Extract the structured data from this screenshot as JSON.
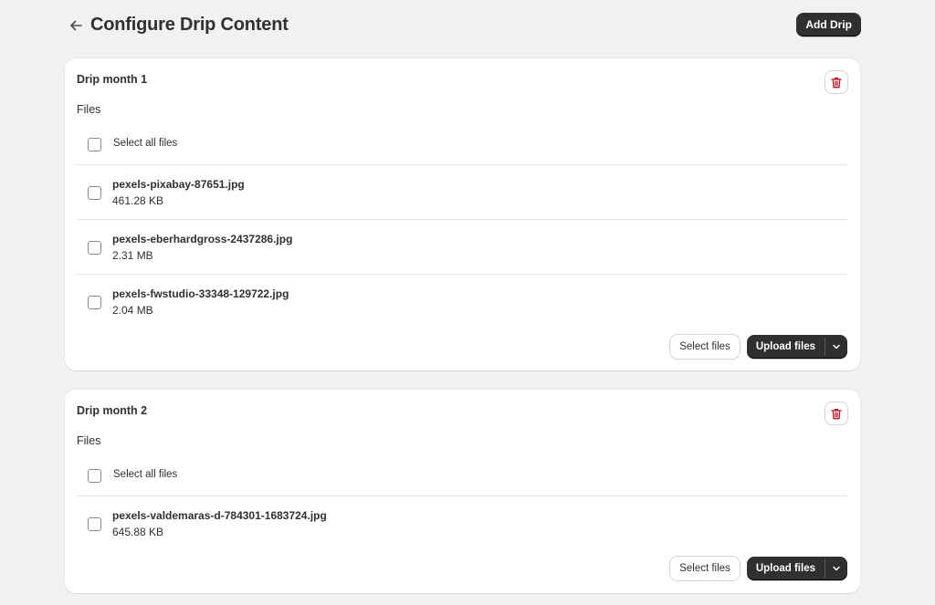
{
  "page": {
    "title": "Configure Drip Content",
    "add_button": "Add Drip"
  },
  "drips": [
    {
      "title": "Drip month 1",
      "files_label": "Files",
      "select_all": "Select all files",
      "files": [
        {
          "name": "pexels-pixabay-87651.jpg",
          "size": "461.28 KB"
        },
        {
          "name": "pexels-eberhardgross-2437286.jpg",
          "size": "2.31 MB"
        },
        {
          "name": "pexels-fwstudio-33348-129722.jpg",
          "size": "2.04 MB"
        }
      ],
      "select_files": "Select files",
      "upload_files": "Upload files"
    },
    {
      "title": "Drip month 2",
      "files_label": "Files",
      "select_all": "Select all files",
      "files": [
        {
          "name": "pexels-valdemaras-d-784301-1683724.jpg",
          "size": "645.88 KB"
        }
      ],
      "select_files": "Select files",
      "upload_files": "Upload files"
    }
  ],
  "icons": {
    "back": "arrow-left-icon",
    "delete": "trash-icon",
    "dropdown": "chevron-down-icon"
  },
  "colors": {
    "primary": "#303030",
    "danger": "#c4101f",
    "background": "#f1f1f1",
    "card": "#ffffff"
  }
}
